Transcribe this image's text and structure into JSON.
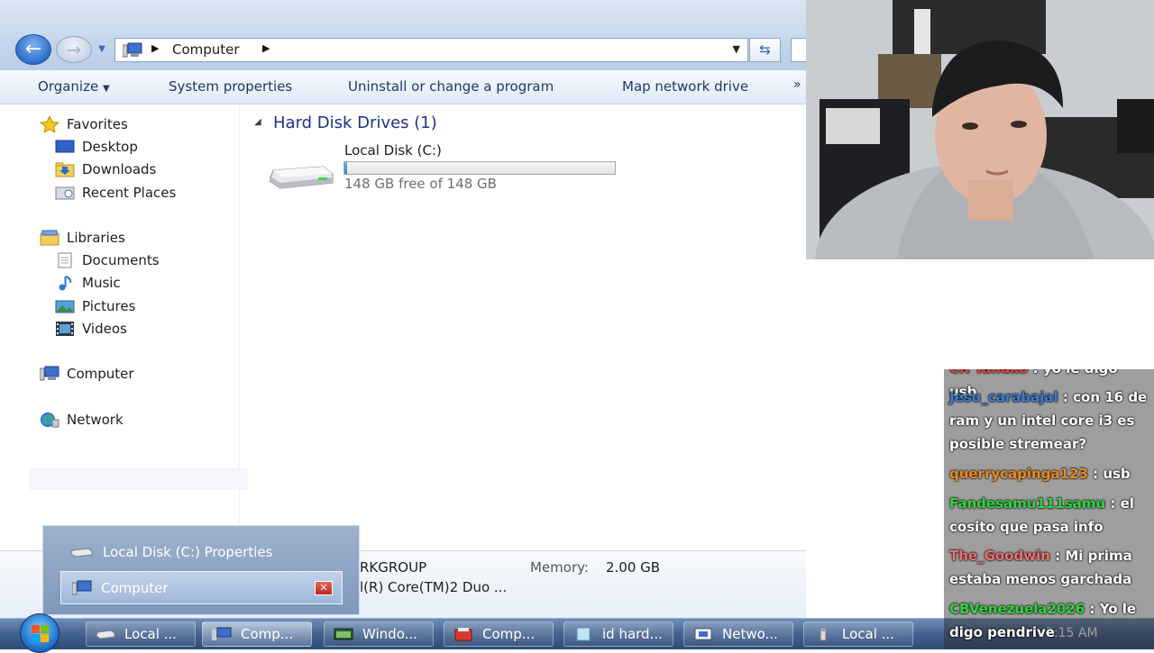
{
  "window": {
    "address_path": "Computer",
    "toolbar": {
      "organize": "Organize",
      "system_properties": "System properties",
      "uninstall": "Uninstall or change a program",
      "map_drive": "Map network drive",
      "more": "»"
    }
  },
  "navigation": {
    "favorites": "Favorites",
    "desktop": "Desktop",
    "downloads": "Downloads",
    "recent_places": "Recent Places",
    "libraries": "Libraries",
    "documents": "Documents",
    "music": "Music",
    "pictures": "Pictures",
    "videos": "Videos",
    "computer": "Computer",
    "network": "Network"
  },
  "content": {
    "group_header": "Hard Disk Drives (1)",
    "drive": {
      "name": "Local Disk (C:)",
      "free_text": "148 GB free of 148 GB",
      "used_fraction": 0.01
    }
  },
  "details": {
    "workgroup": "RKGROUP",
    "memory_label": "Memory:",
    "memory_value": "2.00 GB",
    "processor": "l(R) Core(TM)2 Duo ..."
  },
  "preview": {
    "item1": "Local Disk (C:) Properties",
    "item2": "Computer",
    "close": "✕"
  },
  "taskbar": {
    "buttons": [
      "Local ...",
      "Comp...",
      "Windo...",
      "Comp...",
      "id hard...",
      "Netwo...",
      "Local ..."
    ],
    "clock": "3:15 AM"
  },
  "chat": {
    "messages": [
      {
        "user": "CR Tanuko",
        "text": ": yo le digo usb",
        "color": "#e04040"
      },
      {
        "user": "Jesu_carabajal",
        "text": ": con 16 de ram y un intel core i3 es posible stremear?",
        "color": "#3c7bd6"
      },
      {
        "user": "querrycapinga123",
        "text": ": usb",
        "color": "#f08a1c"
      },
      {
        "user": "Fandesamu111samu",
        "text": ": el cosito que pasa info",
        "color": "#2fd63a"
      },
      {
        "user": "The_Goodwin",
        "text": ": Mi prima estaba menos garchada",
        "color": "#f07070"
      },
      {
        "user": "CBVenezuela2026",
        "text": ": Yo le digo pendrive",
        "color": "#2fd63a"
      }
    ]
  },
  "colors": {
    "accent": "#1e3287",
    "taskbar": "#44628e",
    "drive_bar": "#2a86d9"
  }
}
